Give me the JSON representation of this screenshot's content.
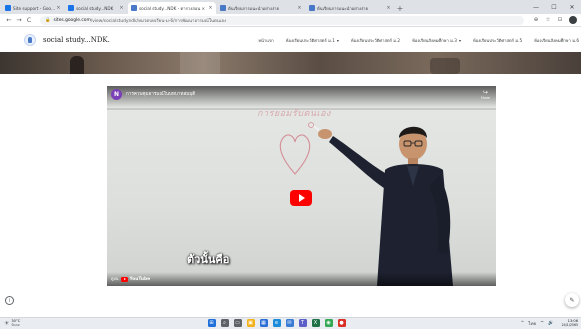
{
  "browser": {
    "tabs": [
      {
        "label": "Site support - Google Sinsk",
        "favicon_color": "#1a73e8",
        "active": false,
        "wide": false
      },
      {
        "label": "social study...NDK",
        "favicon_color": "#1a73e8",
        "active": false,
        "wide": false
      },
      {
        "label": "social study...NDK - ตารางสอน ×",
        "favicon_color": "#4a78c8",
        "active": true,
        "wide": true
      },
      {
        "label": "ต้นเรียนการแนะนำอย่างง่าย",
        "favicon_color": "#4a78c8",
        "active": false,
        "wide": true
      },
      {
        "label": "ต้นเรียนการแนะนำอย่างง่าย",
        "favicon_color": "#4a78c8",
        "active": false,
        "wide": true
      }
    ],
    "new_tab": "+",
    "window_controls": [
      "—",
      "☐",
      "✕"
    ],
    "nav_buttons": [
      "←",
      "→",
      "C"
    ],
    "url_host": "sites.google.com",
    "url_path": "/view/socialstudyndk/หมวดบทเรียน-ม-6/การพัฒนาอารมณ์ในตนเอง",
    "toolbar_icons": [
      "⊕",
      "☆",
      "⊡"
    ]
  },
  "site": {
    "title": "social study...NDK.",
    "nav": [
      {
        "label": "หน้าแรก",
        "has_chevron": false
      },
      {
        "label": "ห้องเรียนประวัติศาสตร์ ม.1",
        "has_chevron": true
      },
      {
        "label": "ห้องเรียนประวัติศาสตร์ ม.2",
        "has_chevron": false
      },
      {
        "label": "ห้องเรียนสังคมศึกษา ม.3",
        "has_chevron": true
      },
      {
        "label": "ห้องเรียนประวัติศาสตร์ ม.5",
        "has_chevron": false
      },
      {
        "label": "ห้องเรียนสังคมศึกษา ม.6",
        "has_chevron": false
      }
    ]
  },
  "video": {
    "channel_initial": "N",
    "title": "การควบคุมอารมณ์ในบทบาทสมมุติ",
    "share_label": "Share",
    "share_icon": "↪",
    "board_text": "การยอมรับตนเอง",
    "caption": "ตัวนั้นคือ",
    "watch_on": "ดูบน",
    "youtube_label": "YouTube",
    "accent": "#ff0000"
  },
  "page": {
    "info_icon": "i",
    "edit_icon": "✎"
  },
  "taskbar": {
    "weather_temp": "30°C",
    "weather_desc": "มีแดด",
    "weather_icon": "☀",
    "apps": [
      {
        "name": "windows-start",
        "glyph": "⊞",
        "color": "#1e6fd9"
      },
      {
        "name": "search",
        "glyph": "⌕",
        "color": "#5f6368"
      },
      {
        "name": "task-view",
        "glyph": "▭",
        "color": "#5f6368"
      },
      {
        "name": "file-explorer",
        "glyph": "▣",
        "color": "#f3b21b"
      },
      {
        "name": "store",
        "glyph": "▦",
        "color": "#2b6fd6"
      },
      {
        "name": "edge",
        "glyph": "e",
        "color": "#1b8cd9"
      },
      {
        "name": "mail",
        "glyph": "✉",
        "color": "#3a7bd5"
      },
      {
        "name": "teams",
        "glyph": "T",
        "color": "#5b5fc7"
      },
      {
        "name": "excel",
        "glyph": "X",
        "color": "#1e7145"
      },
      {
        "name": "chrome",
        "glyph": "◉",
        "color": "#34a853"
      },
      {
        "name": "app-red",
        "glyph": "●",
        "color": "#d93025"
      }
    ],
    "tray_icons": [
      "^",
      "ไทย",
      "⌔",
      "🔊"
    ],
    "time": "13:06",
    "date": "24/1/2565"
  }
}
